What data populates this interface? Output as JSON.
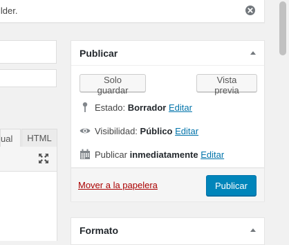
{
  "notice": {
    "text": "ilder.",
    "dismiss_icon": "dismiss-icon"
  },
  "editor": {
    "tabs": [
      {
        "label": "ual"
      },
      {
        "label": "HTML"
      }
    ],
    "fullscreen_icon": "fullscreen-icon"
  },
  "publish": {
    "title": "Publicar",
    "save_draft": "Solo guardar",
    "preview": "Vista previa",
    "status": {
      "label": "Estado:",
      "value": "Borrador",
      "edit": "Editar",
      "icon": "pin-icon"
    },
    "visibility": {
      "label": "Visibilidad:",
      "value": "Público",
      "edit": "Editar",
      "icon": "eye-icon"
    },
    "schedule": {
      "label": "Publicar",
      "value": "inmediatamente",
      "edit": "Editar",
      "icon": "calendar-icon"
    },
    "trash": "Mover a la papelera",
    "publish_button": "Publicar"
  },
  "format_box": {
    "title": "Formato"
  },
  "colors": {
    "primary": "#0085ba",
    "link": "#0073aa",
    "trash": "#aa0000"
  }
}
